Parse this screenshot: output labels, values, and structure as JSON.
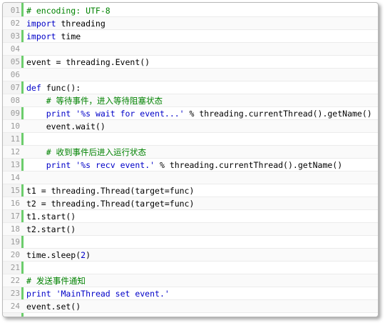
{
  "colors": {
    "keyword": "#0000c8",
    "comment": "#008200",
    "string": "#0000c8",
    "number": "#0000c8",
    "plain": "#000000",
    "line_number": "#9a9a9a",
    "gutter_border": "#6ccd6c"
  },
  "code": {
    "lines": [
      {
        "num": "01",
        "tokens": [
          {
            "t": "comment",
            "v": "# encoding: UTF-8"
          }
        ]
      },
      {
        "num": "02",
        "tokens": [
          {
            "t": "keyword",
            "v": "import"
          },
          {
            "t": "plain",
            "v": " threading"
          }
        ]
      },
      {
        "num": "03",
        "tokens": [
          {
            "t": "keyword",
            "v": "import"
          },
          {
            "t": "plain",
            "v": " time"
          }
        ]
      },
      {
        "num": "04",
        "tokens": []
      },
      {
        "num": "05",
        "tokens": [
          {
            "t": "plain",
            "v": "event = threading.Event()"
          }
        ]
      },
      {
        "num": "06",
        "tokens": []
      },
      {
        "num": "07",
        "tokens": [
          {
            "t": "keyword",
            "v": "def"
          },
          {
            "t": "plain",
            "v": " func():"
          }
        ]
      },
      {
        "num": "08",
        "tokens": [
          {
            "t": "plain",
            "v": "    "
          },
          {
            "t": "comment",
            "v": "# 等待事件，进入等待阻塞状态"
          }
        ]
      },
      {
        "num": "09",
        "tokens": [
          {
            "t": "plain",
            "v": "    "
          },
          {
            "t": "keyword",
            "v": "print"
          },
          {
            "t": "plain",
            "v": " "
          },
          {
            "t": "string",
            "v": "'%s wait for event...'"
          },
          {
            "t": "plain",
            "v": " % threading.currentThread().getName()"
          }
        ]
      },
      {
        "num": "10",
        "tokens": [
          {
            "t": "plain",
            "v": "    event.wait()"
          }
        ]
      },
      {
        "num": "11",
        "tokens": []
      },
      {
        "num": "12",
        "tokens": [
          {
            "t": "plain",
            "v": "    "
          },
          {
            "t": "comment",
            "v": "# 收到事件后进入运行状态"
          }
        ]
      },
      {
        "num": "13",
        "tokens": [
          {
            "t": "plain",
            "v": "    "
          },
          {
            "t": "keyword",
            "v": "print"
          },
          {
            "t": "plain",
            "v": " "
          },
          {
            "t": "string",
            "v": "'%s recv event.'"
          },
          {
            "t": "plain",
            "v": " % threading.currentThread().getName()"
          }
        ]
      },
      {
        "num": "14",
        "tokens": []
      },
      {
        "num": "15",
        "tokens": [
          {
            "t": "plain",
            "v": "t1 = threading.Thread(target=func)"
          }
        ]
      },
      {
        "num": "16",
        "tokens": [
          {
            "t": "plain",
            "v": "t2 = threading.Thread(target=func)"
          }
        ]
      },
      {
        "num": "17",
        "tokens": [
          {
            "t": "plain",
            "v": "t1.start()"
          }
        ]
      },
      {
        "num": "18",
        "tokens": [
          {
            "t": "plain",
            "v": "t2.start()"
          }
        ]
      },
      {
        "num": "19",
        "tokens": []
      },
      {
        "num": "20",
        "tokens": [
          {
            "t": "plain",
            "v": "time.sleep("
          },
          {
            "t": "number",
            "v": "2"
          },
          {
            "t": "plain",
            "v": ")"
          }
        ]
      },
      {
        "num": "21",
        "tokens": []
      },
      {
        "num": "22",
        "tokens": [
          {
            "t": "comment",
            "v": "# 发送事件通知"
          }
        ]
      },
      {
        "num": "23",
        "tokens": [
          {
            "t": "keyword",
            "v": "print"
          },
          {
            "t": "plain",
            "v": " "
          },
          {
            "t": "string",
            "v": "'MainThread set event.'"
          }
        ]
      },
      {
        "num": "24",
        "tokens": [
          {
            "t": "plain",
            "v": "event.set()"
          }
        ]
      }
    ]
  }
}
